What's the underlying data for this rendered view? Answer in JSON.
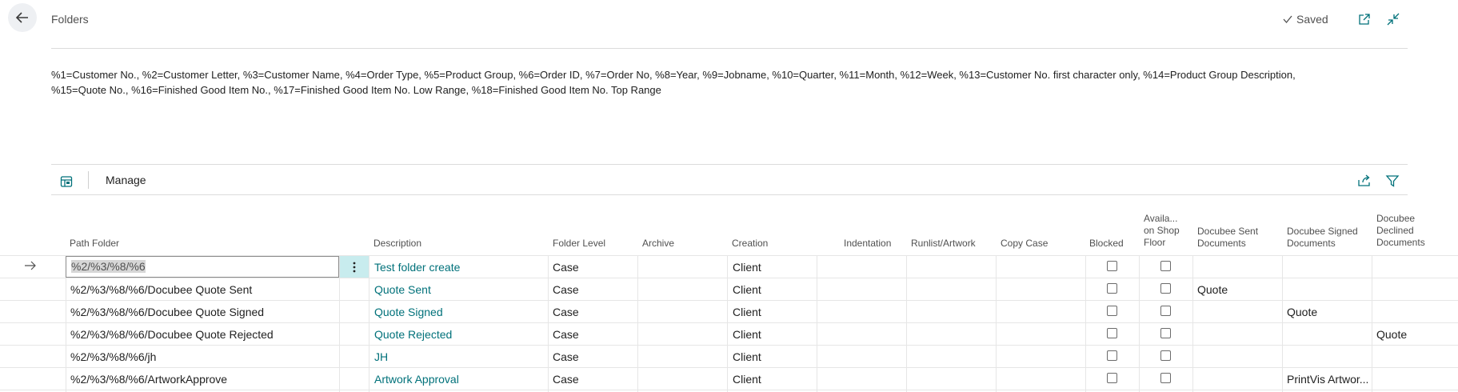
{
  "header": {
    "title": "Folders",
    "status": "Saved"
  },
  "instructions": {
    "line1": "%1=Customer No., %2=Customer Letter, %3=Customer Name, %4=Order Type, %5=Product Group, %6=Order ID, %7=Order No, %8=Year, %9=Jobname, %10=Quarter, %11=Month, %12=Week, %13=Customer No. first character only, %14=Product Group Description,",
    "line2": "%15=Quote No., %16=Finished Good Item No., %17=Finished Good Item No. Low Range, %18=Finished Good Item No. Top Range"
  },
  "actionbar": {
    "manage_label": "Manage"
  },
  "table": {
    "columns": {
      "path_folder": "Path Folder",
      "description": "Description",
      "folder_level": "Folder Level",
      "archive": "Archive",
      "creation": "Creation",
      "indentation": "Indentation",
      "runlist_artwork": "Runlist/Artwork",
      "copy_case": "Copy Case",
      "blocked": "Blocked",
      "available_l1": "Availa...",
      "available_l2": "on Shop",
      "available_l3": "Floor",
      "docubee_sent_l1": "Docubee Sent",
      "docubee_sent_l2": "Documents",
      "docubee_signed_l1": "Docubee Signed",
      "docubee_signed_l2": "Documents",
      "docubee_declined_l1": "Docubee",
      "docubee_declined_l2": "Declined",
      "docubee_declined_l3": "Documents"
    },
    "rows": [
      {
        "path": "%2/%3/%8/%6",
        "description": "Test folder create",
        "level": "Case",
        "creation": "Client",
        "docubee_sent": "",
        "docubee_signed": "",
        "docubee_declined": ""
      },
      {
        "path": "%2/%3/%8/%6/Docubee Quote Sent",
        "description": "Quote Sent",
        "level": "Case",
        "creation": "Client",
        "docubee_sent": "Quote",
        "docubee_signed": "",
        "docubee_declined": ""
      },
      {
        "path": "%2/%3/%8/%6/Docubee Quote Signed",
        "description": "Quote Signed",
        "level": "Case",
        "creation": "Client",
        "docubee_sent": "",
        "docubee_signed": "Quote",
        "docubee_declined": ""
      },
      {
        "path": "%2/%3/%8/%6/Docubee Quote Rejected",
        "description": "Quote Rejected",
        "level": "Case",
        "creation": "Client",
        "docubee_sent": "",
        "docubee_signed": "",
        "docubee_declined": "Quote"
      },
      {
        "path": "%2/%3/%8/%6/jh",
        "description": "JH",
        "level": "Case",
        "creation": "Client",
        "docubee_sent": "",
        "docubee_signed": "",
        "docubee_declined": ""
      },
      {
        "path": "%2/%3/%8/%6/ArtworkApprove",
        "description": "Artwork Approval",
        "level": "Case",
        "creation": "Client",
        "docubee_sent": "",
        "docubee_signed": "PrintVis Artwor...",
        "docubee_declined": ""
      }
    ]
  },
  "colors": {
    "accent": "#00717a",
    "selected_cell": "#c8ecee"
  },
  "icons": [
    "back-arrow-icon",
    "checkmark-icon",
    "open-new-window-icon",
    "collapse-icon",
    "table-view-icon",
    "share-icon",
    "filter-icon",
    "more-options-icon",
    "row-pointer-icon"
  ]
}
